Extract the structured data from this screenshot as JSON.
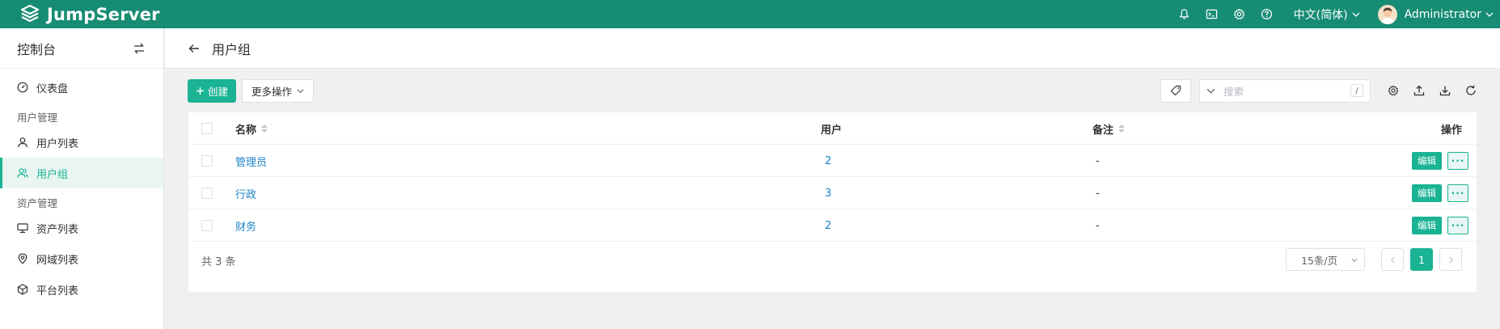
{
  "brand": {
    "name": "JumpServer"
  },
  "topbar": {
    "icons": [
      "bell-icon",
      "terminal-icon",
      "gear-icon",
      "help-icon"
    ],
    "language": "中文(简体)",
    "user_name": "Administrator"
  },
  "sidebar": {
    "title": "控制台",
    "dashboard": "仪表盘",
    "groups": [
      {
        "label": "用户管理",
        "items": [
          {
            "label": "用户列表",
            "icon": "user-icon"
          },
          {
            "label": "用户组",
            "icon": "users-icon",
            "active": true
          }
        ]
      },
      {
        "label": "资产管理",
        "items": [
          {
            "label": "资产列表",
            "icon": "monitor-icon"
          },
          {
            "label": "网域列表",
            "icon": "location-icon"
          },
          {
            "label": "平台列表",
            "icon": "box-icon"
          }
        ]
      }
    ]
  },
  "page": {
    "title": "用户组"
  },
  "toolbar": {
    "create_label": "创建",
    "more_label": "更多操作",
    "search_placeholder": "搜索",
    "search_shortcut": "/"
  },
  "table": {
    "columns": {
      "name": "名称",
      "users": "用户",
      "comment": "备注",
      "actions": "操作"
    },
    "rows": [
      {
        "name": "管理员",
        "users": "2",
        "comment": "-"
      },
      {
        "name": "行政",
        "users": "3",
        "comment": "-"
      },
      {
        "name": "财务",
        "users": "2",
        "comment": "-"
      }
    ],
    "edit_label": "编辑",
    "more_label": "···"
  },
  "pagination": {
    "total_text": "共 3 条",
    "page_size": "15条/页",
    "current_page": "1"
  },
  "colors": {
    "topbar": "#178c74",
    "accent": "#1ab394",
    "link": "#1c84c6"
  }
}
